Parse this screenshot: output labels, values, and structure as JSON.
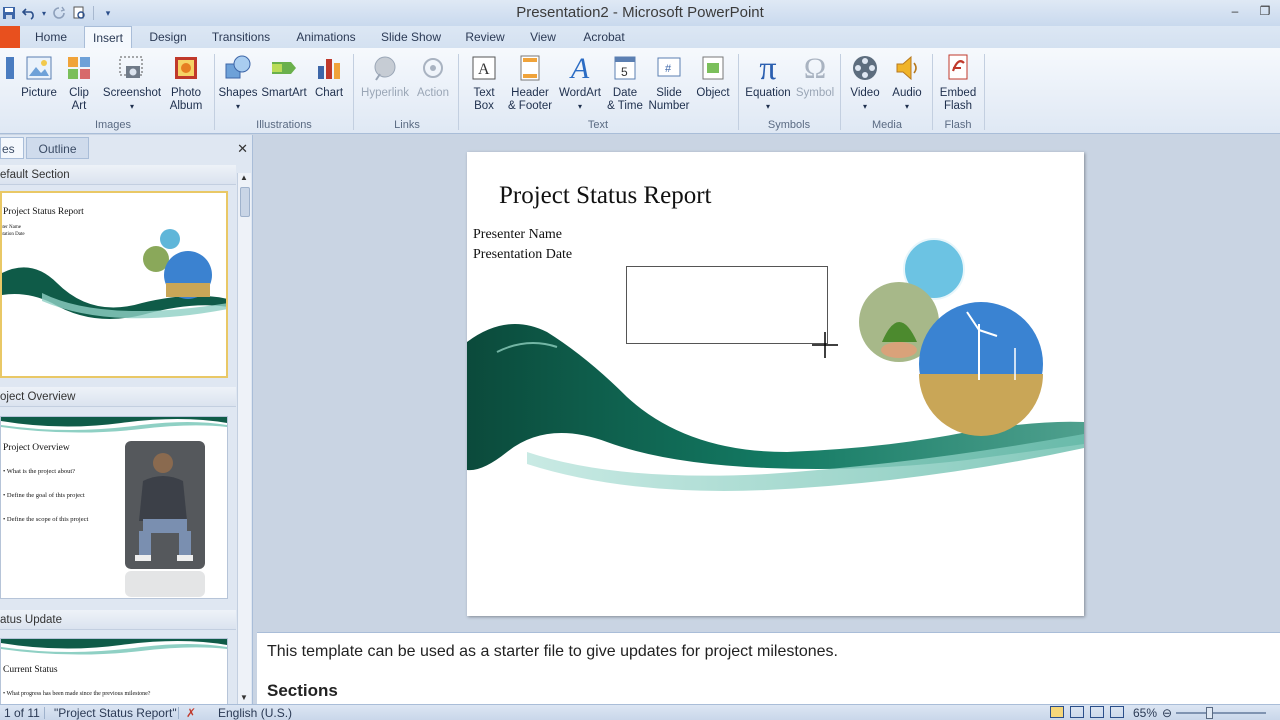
{
  "window": {
    "title": "Presentation2 - Microsoft PowerPoint",
    "min_glyph": "–",
    "restore_glyph": "❐"
  },
  "tabs": [
    "Home",
    "Insert",
    "Design",
    "Transitions",
    "Animations",
    "Slide Show",
    "Review",
    "View",
    "Acrobat"
  ],
  "ribbon": {
    "buttons": {
      "picture": "Picture",
      "clip_art": [
        "Clip",
        "Art"
      ],
      "screenshot": "Screenshot",
      "photo_album": [
        "Photo",
        "Album"
      ],
      "shapes": "Shapes",
      "smartart": "SmartArt",
      "chart": "Chart",
      "hyperlink": "Hyperlink",
      "action": "Action",
      "text_box": [
        "Text",
        "Box"
      ],
      "header_footer": [
        "Header",
        "& Footer"
      ],
      "wordart": "WordArt",
      "date_time": [
        "Date",
        "& Time"
      ],
      "slide_number": [
        "Slide",
        "Number"
      ],
      "object": "Object",
      "equation": "Equation",
      "symbol": "Symbol",
      "video": "Video",
      "audio": "Audio",
      "embed_flash": [
        "Embed",
        "Flash"
      ]
    },
    "groups": {
      "images": "Images",
      "illustrations": "Illustrations",
      "links": "Links",
      "text": "Text",
      "symbols": "Symbols",
      "media": "Media",
      "flash": "Flash"
    },
    "icons": {
      "pi": "π",
      "omega": "Ω",
      "wordart_a": "A"
    }
  },
  "left_panel": {
    "tab_slides_partial": "es",
    "tab_outline": "Outline",
    "close_glyph": "✕",
    "sections": [
      "efault Section",
      "oject Overview",
      "atus Update"
    ],
    "thumbs": [
      {
        "title": "Project Status Report",
        "lines": [
          "nter Name",
          "ntation Date"
        ]
      },
      {
        "title": "Project Overview",
        "bullets": [
          "What is the project about?",
          "Define the goal of this project",
          "Define the scope of this project"
        ]
      },
      {
        "title": "Current Status",
        "bullets": [
          "What progress has been made since the previous milestone?"
        ]
      }
    ]
  },
  "slide": {
    "title": "Project Status Report",
    "presenter": "Presenter Name",
    "date": "Presentation Date"
  },
  "notes": {
    "text": "This template can be used as a starter file to give updates for project milestones.",
    "heading": "Sections"
  },
  "status": {
    "slide_of": "1 of 11",
    "theme": "\"Project Status Report\"",
    "language": "English (U.S.)",
    "zoom": "65%"
  },
  "colors": {
    "accent": "#2b579a",
    "file_tab": "#e8501e",
    "wave_dark": "#0f5b48",
    "wave_light": "#8fd0c4"
  }
}
